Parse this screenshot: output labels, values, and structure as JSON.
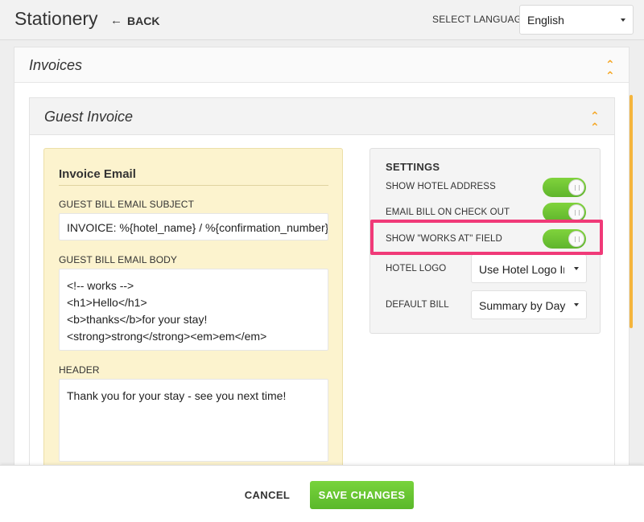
{
  "header": {
    "title": "Stationery",
    "back_label": "BACK",
    "language_label": "SELECT LANGUAGE",
    "language_value": "English"
  },
  "invoices": {
    "title": "Invoices",
    "guest": {
      "title": "Guest Invoice",
      "email": {
        "title": "Invoice Email",
        "subject_label": "GUEST BILL EMAIL SUBJECT",
        "subject_value": "INVOICE: %{hotel_name} / %{confirmation_number}",
        "body_label": "GUEST BILL EMAIL BODY",
        "body_lines": [
          "<!-- works -->",
          "<h1>Hello</h1>",
          "<b>thanks</b>for your stay!",
          "<strong>strong</strong><em>em</em>"
        ],
        "header_label": "HEADER",
        "header_value": "Thank you for your stay - see you next time!"
      },
      "settings": {
        "title": "SETTINGS",
        "show_hotel_address": {
          "label": "SHOW HOTEL ADDRESS",
          "on": true
        },
        "email_bill_checkout": {
          "label": "EMAIL BILL ON CHECK OUT",
          "on": true
        },
        "show_works_at": {
          "label": "SHOW \"WORKS AT\" FIELD",
          "on": true
        },
        "hotel_logo": {
          "label": "HOTEL LOGO",
          "value": "Use Hotel Logo Ima"
        },
        "default_bill": {
          "label": "DEFAULT BILL",
          "value": "Summary by Day"
        }
      }
    }
  },
  "footer": {
    "cancel_label": "CANCEL",
    "save_label": "SAVE CHANGES"
  },
  "colors": {
    "accent_orange": "#f5a623",
    "toggle_green": "#6cc534",
    "highlight_pink": "#f03a78",
    "email_card_bg": "#fcf3ce"
  },
  "icons": [
    "back-arrow-icon",
    "chevron-down-icon",
    "double-chevron-up-icon"
  ]
}
